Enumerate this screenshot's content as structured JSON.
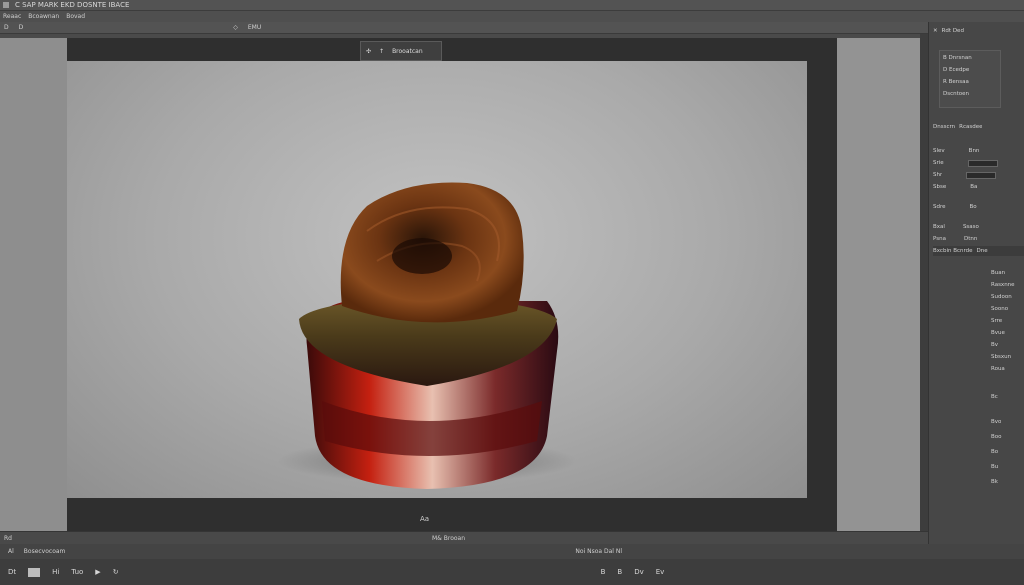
{
  "app": {
    "title": "C SAP MARK EKD DOSNTE IBACE",
    "menu": [
      "Reaac",
      "Bcoawnan",
      "Bovad"
    ],
    "options": [
      "D",
      "D",
      "◇",
      "EMU"
    ]
  },
  "mini_toolbar": {
    "label": "Brooatcan"
  },
  "canvas": {
    "caption": "Aa"
  },
  "status": {
    "left": [
      "Rd"
    ],
    "zoom_text": "M& Brooan"
  },
  "timeline": {
    "row1": [
      "Al",
      "Bosecvocoam",
      "Noi Nsoa Dal Nl"
    ],
    "row2": [
      "Dt",
      "Hi",
      "Tuo"
    ],
    "row2_right": [
      "B",
      "B",
      "Dv",
      "Ev"
    ]
  },
  "panel": {
    "header": "Rdt Ded",
    "group1": [
      "B Dnrsnan",
      "D Ecedpe",
      "R Bensaa",
      "Dscntoen"
    ],
    "labels": [
      "Dnsscrn",
      "Rcasdee",
      "Dne"
    ],
    "props": [
      {
        "k": "Slev",
        "v": "Bnn"
      },
      {
        "k": "Srie",
        "v": ""
      },
      {
        "k": "Shr",
        "v": "B"
      },
      {
        "k": "Sbse",
        "v": "Ba"
      },
      {
        "k": "Sdre",
        "v": "Bo"
      },
      {
        "k": "Bxal",
        "v": "Ssaso"
      },
      {
        "k": "Psna",
        "v": "Dtnn"
      }
    ],
    "layers_header": "Bxcbin Bcnrde",
    "layer_items": [
      "Buan",
      "Rasxnne",
      "Sudoon",
      "Soono",
      "Srre",
      "Bvue",
      "Bv",
      "Sbsxun",
      "Roua",
      "Bc",
      "Bvo",
      "Boo",
      "Bo",
      "Bu",
      "Bk"
    ]
  },
  "colors": {
    "accent": "#4a4a4a",
    "canvas": "#aaaaaa",
    "workspace": "#2f2f2f"
  }
}
